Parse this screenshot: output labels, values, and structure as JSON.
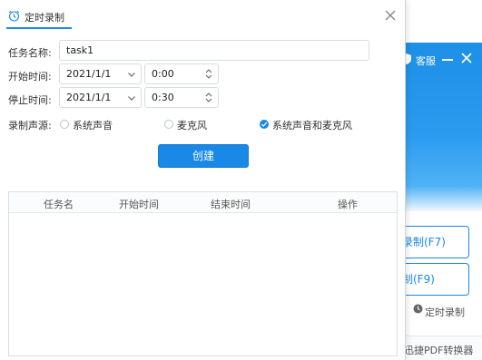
{
  "dialog": {
    "title": "定时录制",
    "fields": {
      "task_name_label": "任务名称:",
      "task_name_value": "task1",
      "start_label": "开始时间:",
      "start_date": "2021/1/1",
      "start_time": "0:00",
      "stop_label": "停止时间:",
      "stop_date": "2021/1/1",
      "stop_time": "0:30"
    },
    "audio": {
      "label": "录制声源:",
      "options": [
        {
          "label": "系统声音",
          "checked": false
        },
        {
          "label": "麦克风",
          "checked": false
        },
        {
          "label": "系统声音和麦克风",
          "checked": true
        }
      ]
    },
    "create_button": "创建",
    "table": {
      "columns": [
        "任务名",
        "开始时间",
        "结束时间",
        "操作"
      ],
      "rows": []
    }
  },
  "background_app": {
    "support_label": "客服",
    "record_button": "录制(F7)",
    "second_button": "制(F9)",
    "timer_link": "定时录制",
    "footer_text": "迅捷PDF转换器",
    "accent_color": "#1a88e6"
  },
  "icons": [
    "alarm-clock-icon",
    "close-icon",
    "chevron-down-icon",
    "spin-updown-icon",
    "checkmark-icon",
    "shield-icon",
    "clock-icon"
  ]
}
